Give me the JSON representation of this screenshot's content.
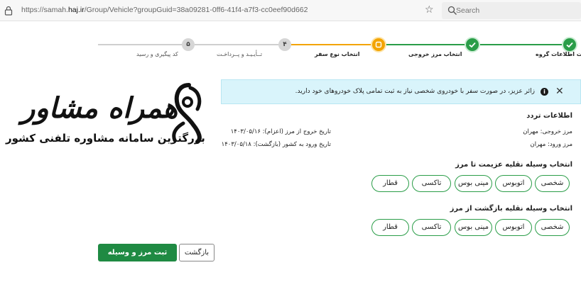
{
  "browser": {
    "url_prefix": "https://samah.",
    "url_domain": "haj.ir",
    "url_suffix": "/Group/Vehicle?groupGuid=38a09281-0ff6-41f4-a7f3-cc0eef90d662",
    "search_placeholder": "Search"
  },
  "stepper": {
    "steps": [
      {
        "number": "",
        "label": "ثبت اطلاعات گروه",
        "state": "done"
      },
      {
        "number": "",
        "label": "انتخاب مرز خروجی",
        "state": "done"
      },
      {
        "number": "",
        "label": "انتخاب نوع سفر",
        "state": "active"
      },
      {
        "number": "۴",
        "label": "تــأیـیـد و پــرداخـت",
        "state": "todo"
      },
      {
        "number": "۵",
        "label": "کد پیگیری و رسید",
        "state": "todo"
      }
    ]
  },
  "alert": {
    "text": "زائر عزیز، در صورت سفر با خودروی شخصی نیاز به ثبت تمامی پلاک خودروهای خود دارید."
  },
  "watermark": {
    "title": "همراه مشاور",
    "subtitle": "بزرگترین سامانه مشاوره تلفنی کشور"
  },
  "traffic_info": {
    "title": "اطلاعات تردد",
    "exit_border": "مرز خروجی: مهران",
    "entry_border": "مرز ورود: مهران",
    "exit_date": "تاریخ خروج از مرز (اعزام): ۱۴۰۳/۰۵/۱۶",
    "entry_date": "تاریخ ورود به کشور (بازگشت): ۱۴۰۳/۰۵/۱۸"
  },
  "departure_vehicle": {
    "title": "انتخاب وسیله نقلیه عزیمت تا مرز",
    "options": [
      "شخصی",
      "اتوبوس",
      "مینی بوس",
      "تاکسی",
      "قطار"
    ]
  },
  "return_vehicle": {
    "title": "انتخاب وسیله نقلیه بازگشت از مرز",
    "options": [
      "شخصی",
      "اتوبوس",
      "مینی بوس",
      "تاکسی",
      "قطار"
    ]
  },
  "actions": {
    "submit_label": "ثبت مرز و وسیله نقلیه",
    "back_label": "بازگشت"
  },
  "colors": {
    "primary_green": "#1f8a43",
    "active_orange": "#f3a400",
    "alert_bg": "#d9f4fb"
  }
}
